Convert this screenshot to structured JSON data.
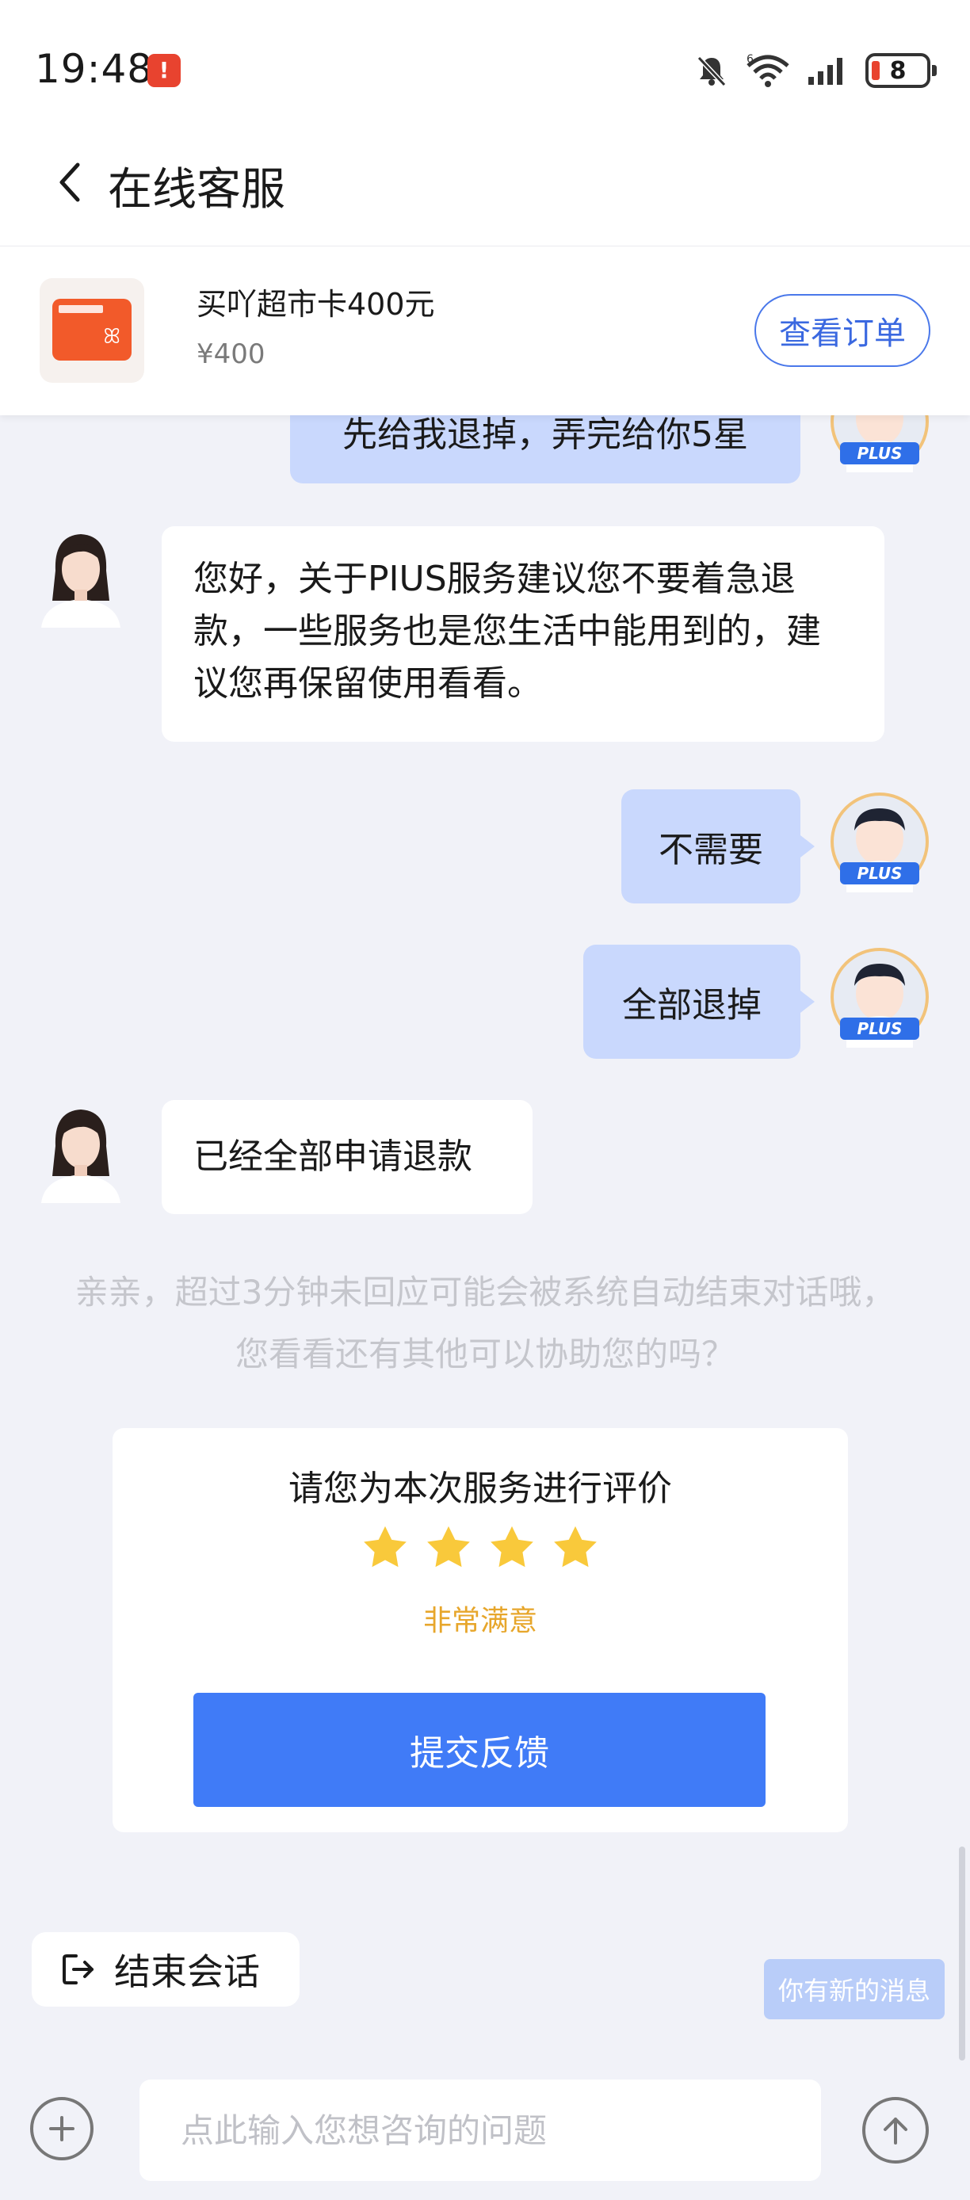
{
  "status_bar": {
    "time": "19:48",
    "alert_badge": "!",
    "battery": "8",
    "signal_label": "6"
  },
  "nav": {
    "title": "在线客服"
  },
  "product": {
    "name": "买吖超市卡400元",
    "price": "¥400",
    "view_order_label": "查看订单",
    "thumb_icon": "rabbit-card-icon"
  },
  "chat": {
    "partial_user_message": "先给我退掉，弄完给你5星",
    "agent_message_1": "您好，关于PIUS服务建议您不要着急退款，一些服务也是您生活中能用到的，建议您再保留使用看看。",
    "user_message_2": "不需要",
    "user_message_3": "全部退掉",
    "agent_message_4": "已经全部申请退款",
    "user_badge": "PLUS"
  },
  "system_note": "亲亲，超过3分钟未回应可能会被系统自动结束对话哦，您看看还有其他可以协助您的吗？",
  "rating": {
    "title": "请您为本次服务进行评价",
    "stars": 4,
    "label": "非常满意",
    "submit_label": "提交反馈",
    "star_color": "#f9c93b",
    "accent_color": "#407bf7"
  },
  "end_session_label": "结束会话",
  "new_message_label": "你有新的消息",
  "input": {
    "placeholder": "点此输入您想咨询的问题",
    "value": ""
  }
}
